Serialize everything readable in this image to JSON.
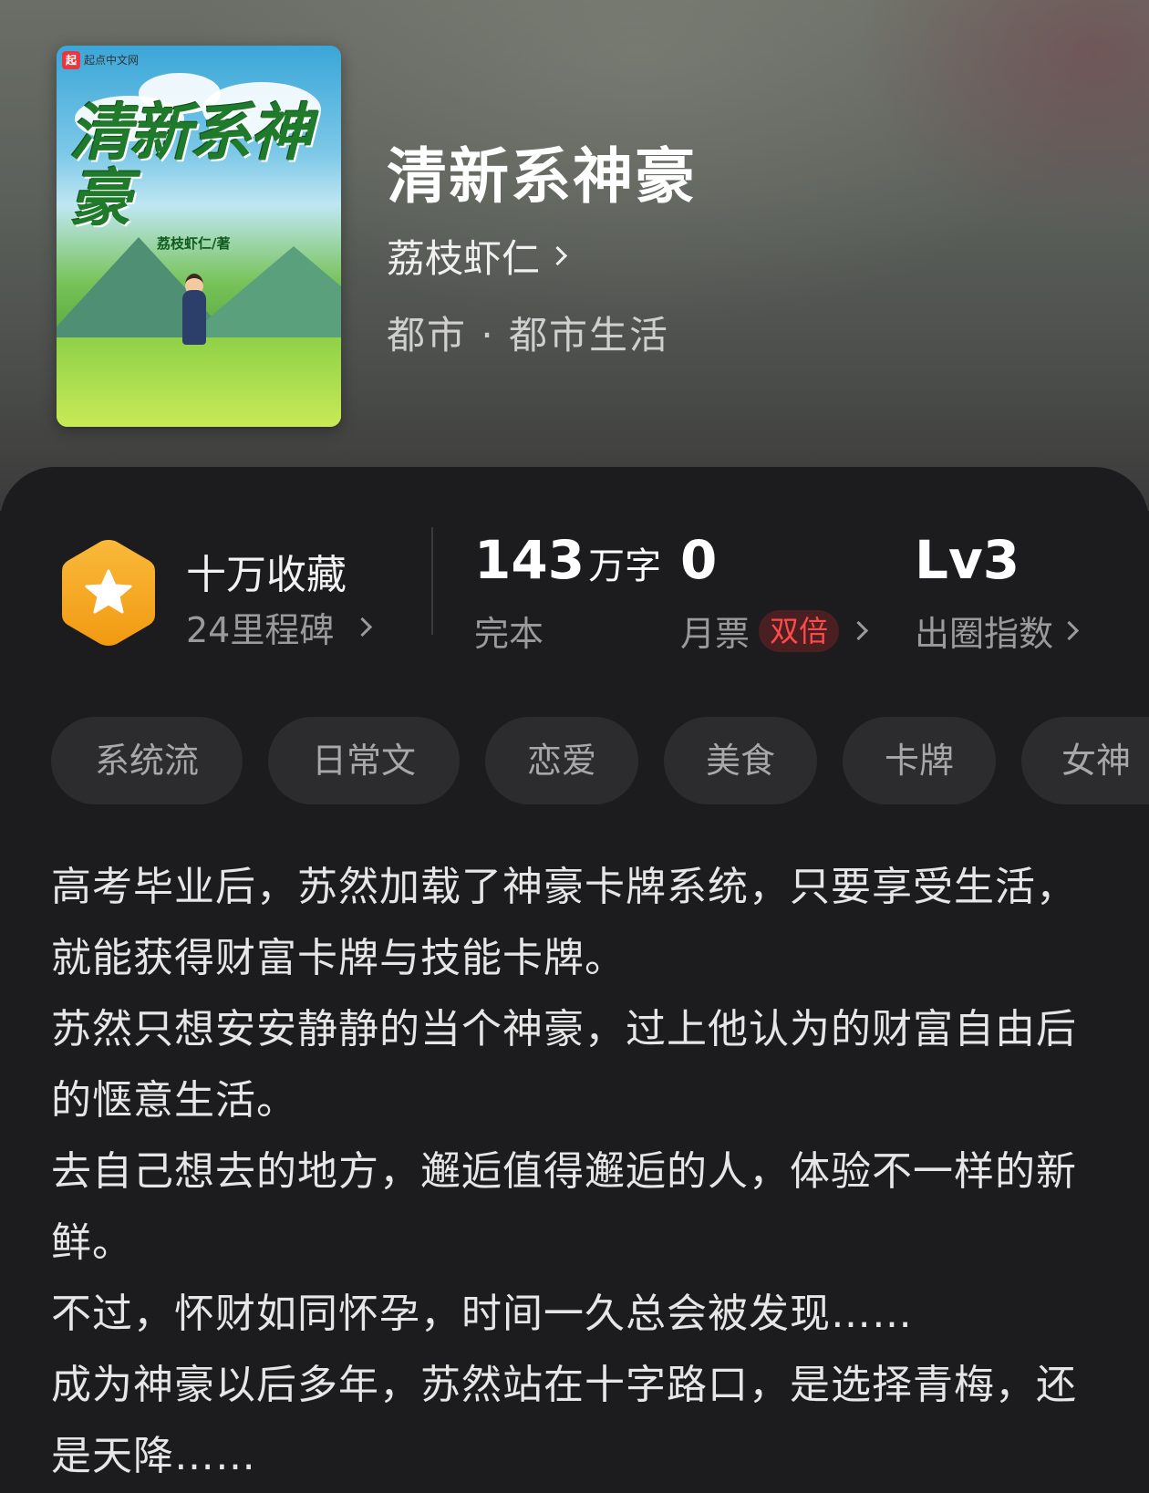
{
  "cover": {
    "publisher": "起点中文网",
    "logo_glyph": "起",
    "title_art": "清新系神豪",
    "author_art": "荔枝虾仁/著"
  },
  "book": {
    "title": "清新系神豪",
    "author": "荔枝虾仁",
    "genre": "都市 · 都市生活"
  },
  "stats": {
    "collect": {
      "label": "十万收藏",
      "sub": "24里程碑"
    },
    "words": {
      "value": "143",
      "unit": "万字",
      "status": "完本"
    },
    "votes": {
      "value": "0",
      "label": "月票",
      "badge": "双倍"
    },
    "level": {
      "value": "Lv3",
      "label": "出圈指数"
    }
  },
  "tags": [
    "系统流",
    "日常文",
    "恋爱",
    "美食",
    "卡牌",
    "女神"
  ],
  "description": [
    "高考毕业后，苏然加载了神豪卡牌系统，只要享受生活，就能获得财富卡牌与技能卡牌。",
    "苏然只想安安静静的当个神豪，过上他认为的财富自由后的惬意生活。",
    "去自己想去的地方，邂逅值得邂逅的人，体验不一样的新鲜。",
    "不过，怀财如同怀孕，时间一久总会被发现……",
    "成为神豪以后多年，苏然站在十字路口，是选择青梅，还是天降……"
  ],
  "colors": {
    "background": "#1c1c1e",
    "badge_orange": "#f6a623",
    "double_badge_text": "#ff4a4a",
    "tag_bg": "#2c2c2e"
  }
}
